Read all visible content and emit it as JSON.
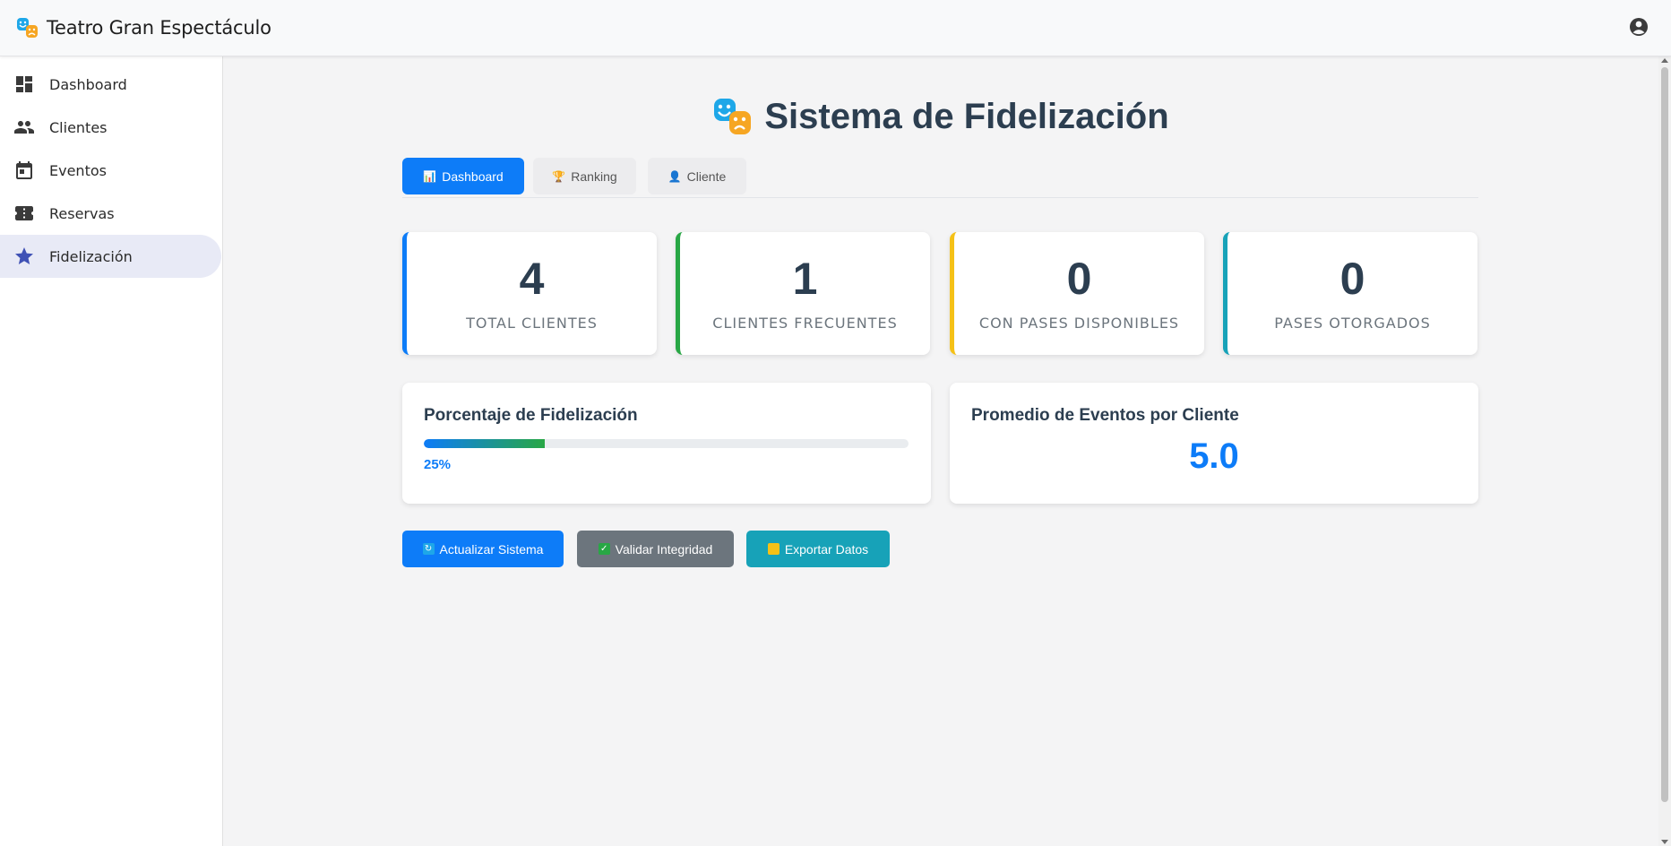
{
  "app": {
    "title": "Teatro Gran Espectáculo"
  },
  "sidebar": {
    "items": [
      {
        "label": "Dashboard",
        "icon": "dashboard-icon"
      },
      {
        "label": "Clientes",
        "icon": "people-icon"
      },
      {
        "label": "Eventos",
        "icon": "calendar-icon"
      },
      {
        "label": "Reservas",
        "icon": "ticket-icon"
      },
      {
        "label": "Fidelización",
        "icon": "star-icon",
        "active": true
      }
    ]
  },
  "main": {
    "title": "Sistema de Fidelización",
    "tabs": [
      {
        "label": "Dashboard",
        "emoji": "📊",
        "active": true
      },
      {
        "label": "Ranking",
        "emoji": "🏆"
      },
      {
        "label": "Cliente",
        "emoji": "👤"
      }
    ],
    "stats": [
      {
        "value": "4",
        "label": "TOTAL CLIENTES",
        "color": "#0d7cf8"
      },
      {
        "value": "1",
        "label": "CLIENTES FRECUENTES",
        "color": "#28a745"
      },
      {
        "value": "0",
        "label": "CON PASES DISPONIBLES",
        "color": "#f5c117"
      },
      {
        "value": "0",
        "label": "PASES OTORGADOS",
        "color": "#17a2b8"
      }
    ],
    "fidelizacion": {
      "title": "Porcentaje de Fidelización",
      "percent": 25,
      "percent_text": "25%"
    },
    "promedio": {
      "title": "Promedio de Eventos por Cliente",
      "value": "5.0"
    },
    "actions": [
      {
        "label": "Actualizar Sistema",
        "color": "#0d7cf8",
        "icon": "refresh-icon"
      },
      {
        "label": "Validar Integridad",
        "color": "#6c757d",
        "icon": "check-icon"
      },
      {
        "label": "Exportar Datos",
        "color": "#17a2b8",
        "icon": "folder-icon"
      }
    ]
  },
  "colors": {
    "accent": "#0d7cf8",
    "sidebar_active": "#e8eaf6"
  }
}
